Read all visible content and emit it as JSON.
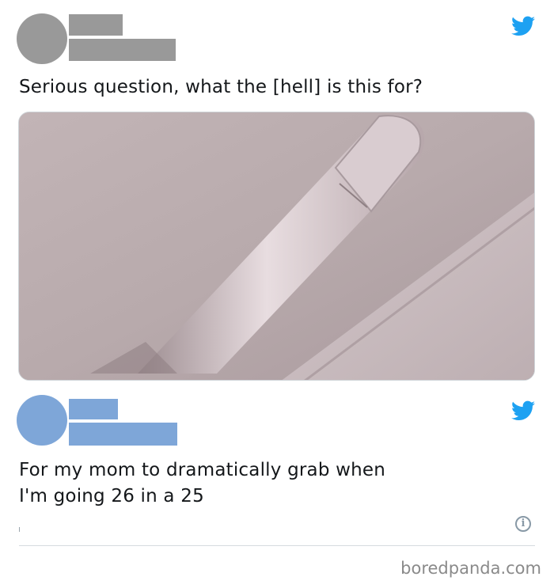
{
  "tweets": [
    {
      "text": "Serious question, what the [hell] is this for?",
      "has_photo": true,
      "avatar_color": "#999999"
    },
    {
      "text": "For my mom to dramatically grab when\nI'm going 26 in a 25",
      "has_photo": false,
      "avatar_color": "#7ea6d8"
    }
  ],
  "brand_icon": "twitter-bird-icon",
  "brand_color": "#1da1f2",
  "info_icon_glyph": "i",
  "watermark": "boredpanda.com"
}
